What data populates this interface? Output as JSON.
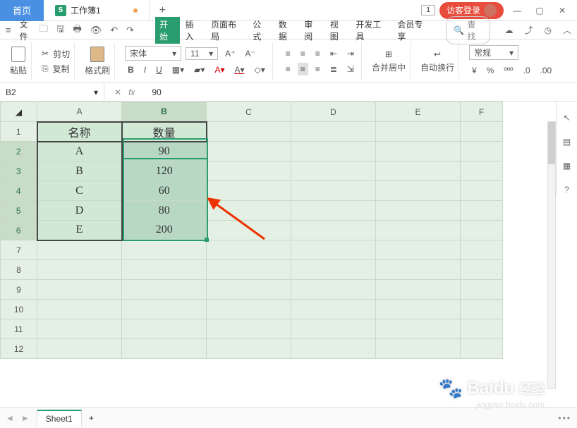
{
  "title_bar": {
    "home": "首页",
    "doc_icon": "S",
    "doc_name": "工作簿1",
    "index_label": "1",
    "guest_label": "访客登录"
  },
  "menu": {
    "file_label": "文件",
    "tabs": [
      "开始",
      "插入",
      "页面布局",
      "公式",
      "数据",
      "审阅",
      "视图",
      "开发工具",
      "会员专享"
    ],
    "search_icon": "Q",
    "search_placeholder": "查找"
  },
  "ribbon": {
    "paste": "粘贴",
    "cut": "剪切",
    "copy": "复制",
    "format_paint": "格式刷",
    "font_name": "宋体",
    "font_size": "11",
    "bold": "B",
    "italic": "I",
    "underline": "U",
    "merge_center": "合并居中",
    "wrap": "自动换行",
    "number_format": "常规",
    "currency": "¥",
    "percent": "%"
  },
  "formula_bar": {
    "name_box": "B2",
    "fx_label": "fx",
    "value": "90"
  },
  "grid": {
    "cols": [
      "A",
      "B",
      "C",
      "D",
      "E",
      "F"
    ],
    "rows": [
      "1",
      "2",
      "3",
      "4",
      "5",
      "6",
      "7",
      "8",
      "9",
      "10",
      "11",
      "12"
    ],
    "headers": {
      "A1": "名称",
      "B1": "数量"
    },
    "data": [
      {
        "name": "A",
        "qty": "90"
      },
      {
        "name": "B",
        "qty": "120"
      },
      {
        "name": "C",
        "qty": "60"
      },
      {
        "name": "D",
        "qty": "80"
      },
      {
        "name": "E",
        "qty": "200"
      }
    ]
  },
  "bottom": {
    "sheet": "Sheet1"
  },
  "watermark": {
    "brand": "Baidu",
    "sub": "经验",
    "url": "jingyan.baidu.com"
  }
}
